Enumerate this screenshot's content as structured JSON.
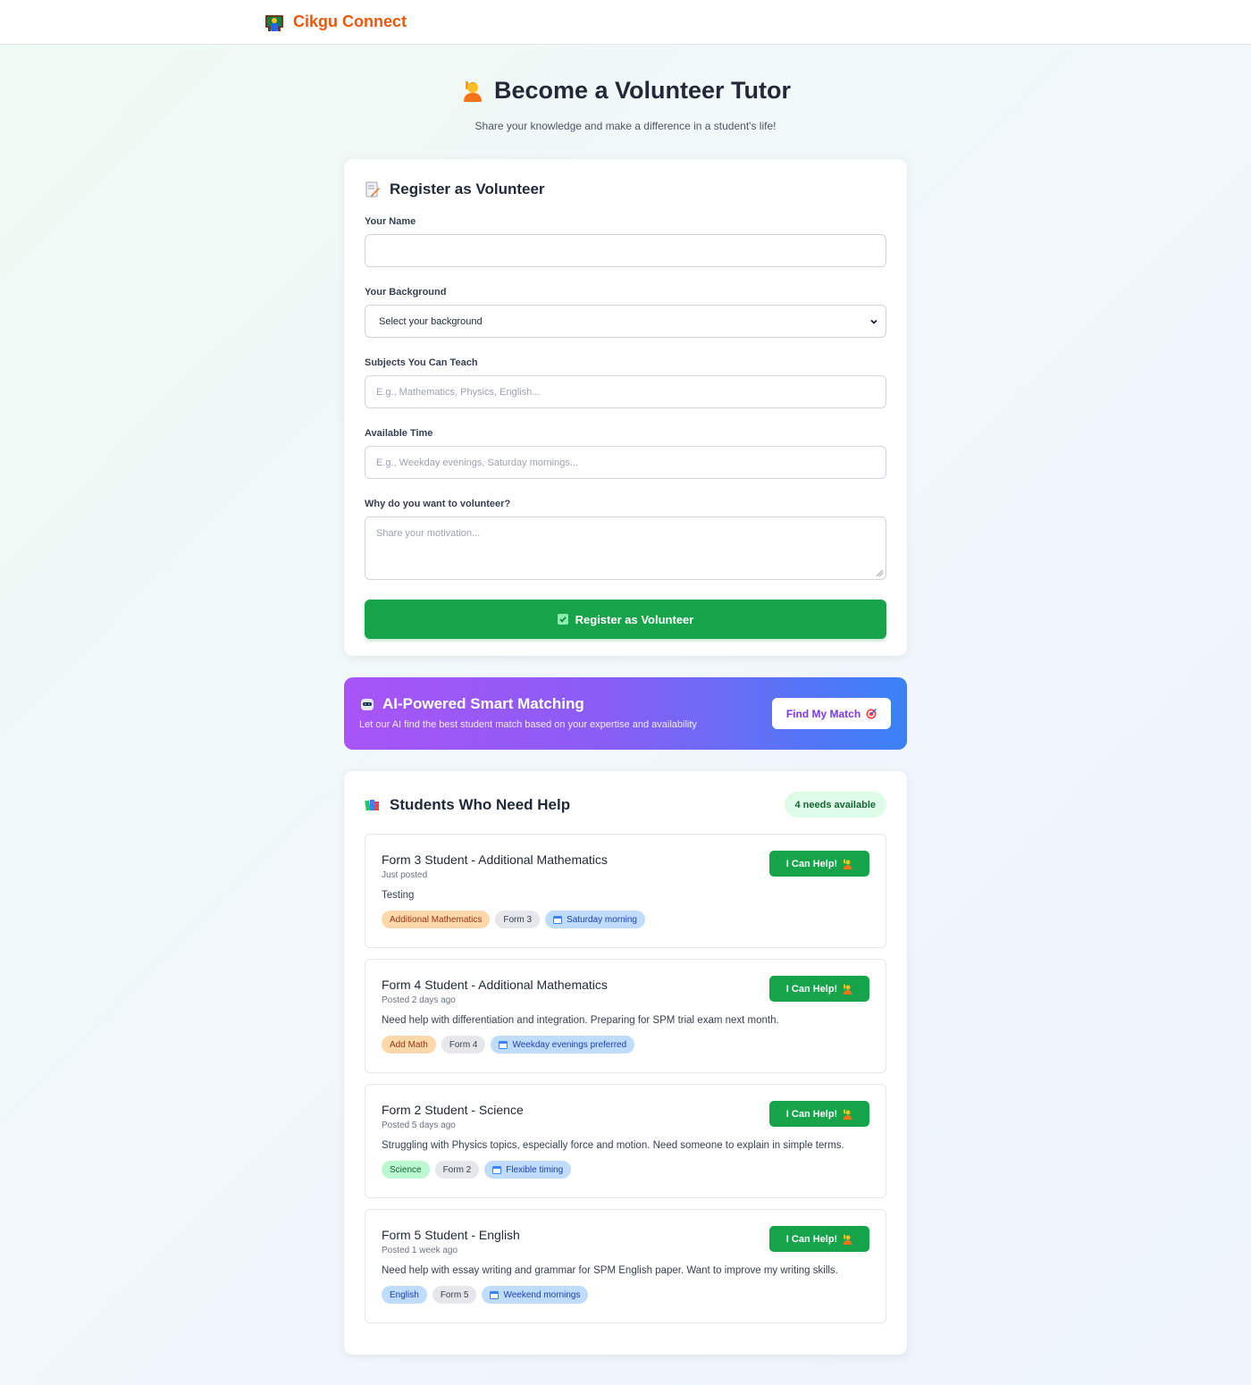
{
  "brand": {
    "name": "Cikgu Connect",
    "icon": "teacher-icon"
  },
  "hero": {
    "title": "Become a Volunteer Tutor",
    "subtitle": "Share your knowledge and make a difference in a student's life!",
    "icon": "raising-hand-icon"
  },
  "registration": {
    "title": "Register as Volunteer",
    "icon": "memo-icon",
    "name_label": "Your Name",
    "name_value": "",
    "background_label": "Your Background",
    "background_selected": "Select your background",
    "subjects_label": "Subjects You Can Teach",
    "subjects_placeholder": "E.g., Mathematics, Physics, English...",
    "time_label": "Available Time",
    "time_placeholder": "E.g., Weekday evenings, Saturday mornings...",
    "motivation_label": "Why do you want to volunteer?",
    "motivation_placeholder": "Share your motivation...",
    "submit_label": "Register as Volunteer",
    "submit_icon": "check-icon"
  },
  "ai_matching": {
    "title": "AI-Powered Smart Matching",
    "description": "Let our AI find the best student match based on your expertise and availability",
    "button_label": "Find My Match",
    "icon": "robot-icon",
    "button_icon": "target-icon"
  },
  "students": {
    "title": "Students Who Need Help",
    "icon": "books-icon",
    "count_label": "4 needs available",
    "help_label": "I Can Help!",
    "requests": [
      {
        "title": "Form 3 Student - Additional Mathematics",
        "posted": "Just posted",
        "description": "Testing",
        "subject": "Additional Mathematics",
        "form": "Form 3",
        "time": "Saturday morning"
      },
      {
        "title": "Form 4 Student - Additional Mathematics",
        "posted": "Posted 2 days ago",
        "description": "Need help with differentiation and integration. Preparing for SPM trial exam next month.",
        "subject": "Add Math",
        "form": "Form 4",
        "time": "Weekday evenings preferred"
      },
      {
        "title": "Form 2 Student - Science",
        "posted": "Posted 5 days ago",
        "description": "Struggling with Physics topics, especially force and motion. Need someone to explain in simple terms.",
        "subject": "Science",
        "form": "Form 2",
        "time": "Flexible timing"
      },
      {
        "title": "Form 5 Student - English",
        "posted": "Posted 1 week ago",
        "description": "Need help with essay writing and grammar for SPM English paper. Want to improve my writing skills.",
        "subject": "English",
        "form": "Form 5",
        "time": "Weekend mornings"
      }
    ]
  },
  "colors": {
    "brand": "#ea580c",
    "primary_green": "#16a34a",
    "banner_start": "#a855f7",
    "banner_end": "#3b82f6"
  }
}
